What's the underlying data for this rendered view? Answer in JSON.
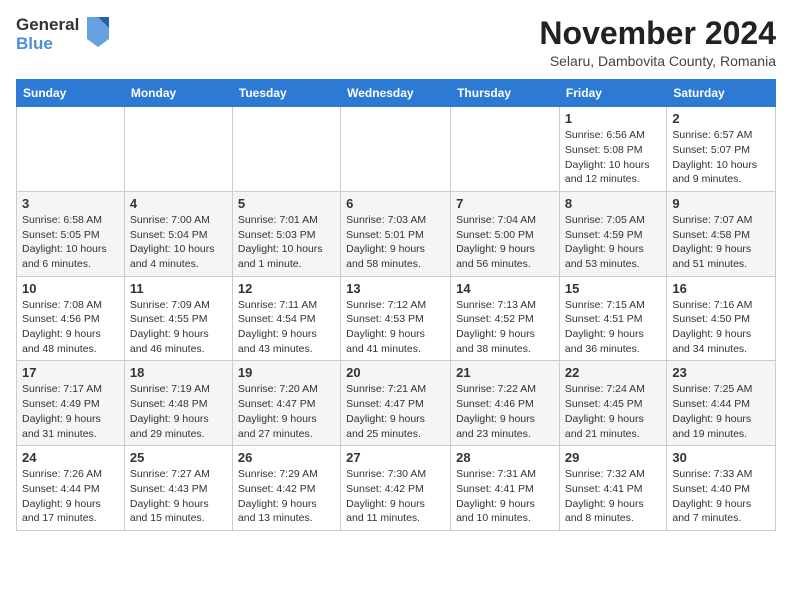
{
  "logo": {
    "general": "General",
    "blue": "Blue"
  },
  "title": "November 2024",
  "subtitle": "Selaru, Dambovita County, Romania",
  "weekdays": [
    "Sunday",
    "Monday",
    "Tuesday",
    "Wednesday",
    "Thursday",
    "Friday",
    "Saturday"
  ],
  "weeks": [
    [
      {
        "day": "",
        "info": ""
      },
      {
        "day": "",
        "info": ""
      },
      {
        "day": "",
        "info": ""
      },
      {
        "day": "",
        "info": ""
      },
      {
        "day": "",
        "info": ""
      },
      {
        "day": "1",
        "info": "Sunrise: 6:56 AM\nSunset: 5:08 PM\nDaylight: 10 hours and 12 minutes."
      },
      {
        "day": "2",
        "info": "Sunrise: 6:57 AM\nSunset: 5:07 PM\nDaylight: 10 hours and 9 minutes."
      }
    ],
    [
      {
        "day": "3",
        "info": "Sunrise: 6:58 AM\nSunset: 5:05 PM\nDaylight: 10 hours and 6 minutes."
      },
      {
        "day": "4",
        "info": "Sunrise: 7:00 AM\nSunset: 5:04 PM\nDaylight: 10 hours and 4 minutes."
      },
      {
        "day": "5",
        "info": "Sunrise: 7:01 AM\nSunset: 5:03 PM\nDaylight: 10 hours and 1 minute."
      },
      {
        "day": "6",
        "info": "Sunrise: 7:03 AM\nSunset: 5:01 PM\nDaylight: 9 hours and 58 minutes."
      },
      {
        "day": "7",
        "info": "Sunrise: 7:04 AM\nSunset: 5:00 PM\nDaylight: 9 hours and 56 minutes."
      },
      {
        "day": "8",
        "info": "Sunrise: 7:05 AM\nSunset: 4:59 PM\nDaylight: 9 hours and 53 minutes."
      },
      {
        "day": "9",
        "info": "Sunrise: 7:07 AM\nSunset: 4:58 PM\nDaylight: 9 hours and 51 minutes."
      }
    ],
    [
      {
        "day": "10",
        "info": "Sunrise: 7:08 AM\nSunset: 4:56 PM\nDaylight: 9 hours and 48 minutes."
      },
      {
        "day": "11",
        "info": "Sunrise: 7:09 AM\nSunset: 4:55 PM\nDaylight: 9 hours and 46 minutes."
      },
      {
        "day": "12",
        "info": "Sunrise: 7:11 AM\nSunset: 4:54 PM\nDaylight: 9 hours and 43 minutes."
      },
      {
        "day": "13",
        "info": "Sunrise: 7:12 AM\nSunset: 4:53 PM\nDaylight: 9 hours and 41 minutes."
      },
      {
        "day": "14",
        "info": "Sunrise: 7:13 AM\nSunset: 4:52 PM\nDaylight: 9 hours and 38 minutes."
      },
      {
        "day": "15",
        "info": "Sunrise: 7:15 AM\nSunset: 4:51 PM\nDaylight: 9 hours and 36 minutes."
      },
      {
        "day": "16",
        "info": "Sunrise: 7:16 AM\nSunset: 4:50 PM\nDaylight: 9 hours and 34 minutes."
      }
    ],
    [
      {
        "day": "17",
        "info": "Sunrise: 7:17 AM\nSunset: 4:49 PM\nDaylight: 9 hours and 31 minutes."
      },
      {
        "day": "18",
        "info": "Sunrise: 7:19 AM\nSunset: 4:48 PM\nDaylight: 9 hours and 29 minutes."
      },
      {
        "day": "19",
        "info": "Sunrise: 7:20 AM\nSunset: 4:47 PM\nDaylight: 9 hours and 27 minutes."
      },
      {
        "day": "20",
        "info": "Sunrise: 7:21 AM\nSunset: 4:47 PM\nDaylight: 9 hours and 25 minutes."
      },
      {
        "day": "21",
        "info": "Sunrise: 7:22 AM\nSunset: 4:46 PM\nDaylight: 9 hours and 23 minutes."
      },
      {
        "day": "22",
        "info": "Sunrise: 7:24 AM\nSunset: 4:45 PM\nDaylight: 9 hours and 21 minutes."
      },
      {
        "day": "23",
        "info": "Sunrise: 7:25 AM\nSunset: 4:44 PM\nDaylight: 9 hours and 19 minutes."
      }
    ],
    [
      {
        "day": "24",
        "info": "Sunrise: 7:26 AM\nSunset: 4:44 PM\nDaylight: 9 hours and 17 minutes."
      },
      {
        "day": "25",
        "info": "Sunrise: 7:27 AM\nSunset: 4:43 PM\nDaylight: 9 hours and 15 minutes."
      },
      {
        "day": "26",
        "info": "Sunrise: 7:29 AM\nSunset: 4:42 PM\nDaylight: 9 hours and 13 minutes."
      },
      {
        "day": "27",
        "info": "Sunrise: 7:30 AM\nSunset: 4:42 PM\nDaylight: 9 hours and 11 minutes."
      },
      {
        "day": "28",
        "info": "Sunrise: 7:31 AM\nSunset: 4:41 PM\nDaylight: 9 hours and 10 minutes."
      },
      {
        "day": "29",
        "info": "Sunrise: 7:32 AM\nSunset: 4:41 PM\nDaylight: 9 hours and 8 minutes."
      },
      {
        "day": "30",
        "info": "Sunrise: 7:33 AM\nSunset: 4:40 PM\nDaylight: 9 hours and 7 minutes."
      }
    ]
  ]
}
